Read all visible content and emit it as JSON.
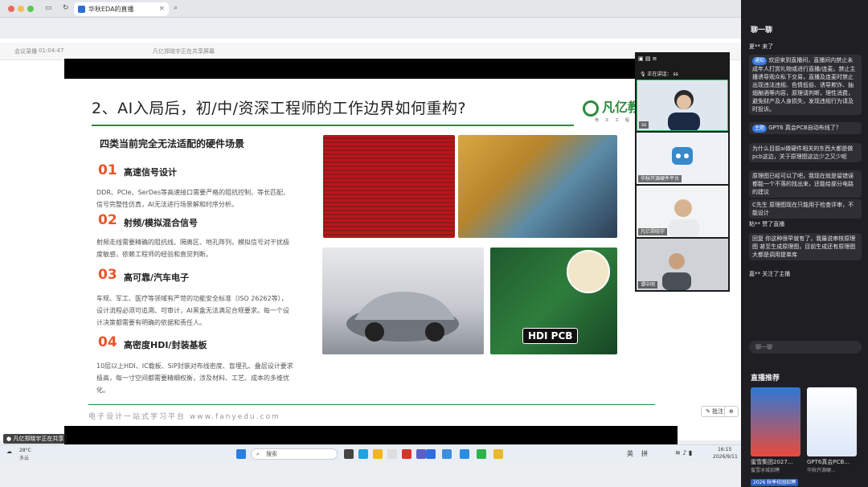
{
  "browser": {
    "tab_title": "华秋EDA的直播"
  },
  "share_bar": {
    "left_items": [
      "会议录播",
      "01:04:47"
    ],
    "center_text": "凡亿郑晓宇正在共享屏幕",
    "notification": "凡亿郑晓宇正在共享"
  },
  "slide": {
    "title": "2、AI入局后，初/中/资深工程师的工作边界如何重构?",
    "logo": "凡亿教育",
    "logo_sub": "电 子 工 程 师 学 习",
    "subtitle": "四类当前完全无法适配的硬件场景",
    "items": [
      {
        "num": "01",
        "head": "高速信号设计",
        "body": "DDR、PCIe、SerDes等高速接口需要严格的阻抗控制、等长匹配、信号完整性仿真，AI无法进行场景解和时序分析。"
      },
      {
        "num": "02",
        "head": "射频/模拟混合信号",
        "body": "射频走线需要精确的阻抗线、隔离区、地孔阵列，模拟信号对干扰极度敏感，依赖工程师的经验和直觉判断。"
      },
      {
        "num": "03",
        "head": "高可靠/汽车电子",
        "body": "车规、军工、医疗等领域有严苛的功能安全标准（ISO 26262等），设计流程必须可追溯、可审计，AI黑盒无法满足合规要求。每一个设计决策都需要有明确的依据和责任人。"
      },
      {
        "num": "04",
        "head": "高密度HDI/封装基板",
        "body": "10层以上HDI、IC载板、SiP封装对布线密度、盲埋孔、叠层设计要求极高，每一寸空间都需要精细权衡，涉及材料、工艺、成本的多维优化。"
      }
    ],
    "hdi_label": "HDI PCB",
    "footer": "电子设计一站式学习平台 www.fanyedu.com",
    "annotate_button": "批注"
  },
  "tiles": {
    "speaking_label": "正在讲话：",
    "speaking_name": "ss",
    "names": [
      "ss",
      "华秋开源硬件平台",
      "凡亿郑晓宇",
      "谭中明"
    ]
  },
  "taskbar": {
    "weather_temp": "28°C",
    "weather_desc": "多云",
    "search": "搜索",
    "lang1": "英",
    "lang2": "拼",
    "time": "16:15",
    "date": "2026/9/11"
  },
  "chat": {
    "title": "聊一聊",
    "messages": [
      {
        "user": "夏**",
        "text": "来了"
      },
      {
        "user": "通知",
        "text": "欢迎来到直播间，直播间内禁止未成年人打赏礼物或进行直播/连麦。禁止主播诱导观众私下交易，直播及连麦时禁止出现违法违规、色情低俗、诱导欺诈、抽烟酗酒等内容，原理请判断，理性消费，避免财产及人身损失，发现违规行为请及时投诉。"
      },
      {
        "user": "主题",
        "text": "GPT6 真会PCB自动布线了？"
      },
      {
        "user": "",
        "text": "为什么目前ai做硬件相关的东西大都是做pcb这边，关于原理图这边少之又少呢"
      },
      {
        "user": "",
        "text": "原理图已经可以了吧，我现在就是留错误都能一个不落的找出来，还能给部分电路的建议"
      },
      {
        "user": "C先生",
        "text": "原理图现在只能用于检查评审，不能设计"
      },
      {
        "user": "粘**",
        "text": "赞了直播"
      },
      {
        "user": "回复",
        "text": "你这种很早就有了，我最说审核原理图 甚至生成原理图，目前生成还有原理图大都是调用提单库"
      },
      {
        "user": "嘉**",
        "text": "关注了主播"
      }
    ],
    "input_placeholder": "聊一聊",
    "rec_title": "直播推荐",
    "cards": [
      {
        "title": "蜜雪集团2027...",
        "sub": "蜜雪冰城招聘"
      },
      {
        "title": "GPT6真会PCB...",
        "sub": "华秋开源硬..."
      }
    ],
    "bottom_tag": "2026 秋季校园招聘"
  }
}
